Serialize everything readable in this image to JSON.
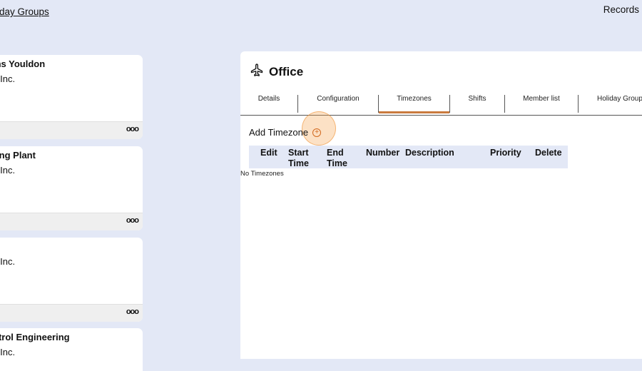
{
  "header": {
    "breadcrumb_link": "iday Groups",
    "records_label": "Records"
  },
  "cards": [
    {
      "title": "ins Youldon",
      "subtitle": "y Inc.",
      "more": "ooo"
    },
    {
      "title": "ring Plant",
      "subtitle": "y Inc.",
      "more": "ooo"
    },
    {
      "title": "",
      "subtitle": "y Inc.",
      "more": "ooo"
    },
    {
      "title": "ntrol Engineering",
      "subtitle": "y Inc.",
      "more": ""
    }
  ],
  "panel": {
    "title": "Office",
    "icon": "airplane-icon",
    "tabs": [
      {
        "label": "Details",
        "active": false
      },
      {
        "label": "Configuration",
        "active": false
      },
      {
        "label": "Timezones",
        "active": true
      },
      {
        "label": "Shifts",
        "active": false
      },
      {
        "label": "Member list",
        "active": false
      },
      {
        "label": "Holiday Group",
        "active": false
      }
    ],
    "add_label": "Add Timezone",
    "table": {
      "columns": [
        "Edit",
        "Start Time",
        "End Time",
        "Number",
        "Description",
        "Priority",
        "Delete"
      ],
      "empty_message": "No Timezones"
    }
  },
  "colors": {
    "background": "#e3e8f6",
    "accent": "#c97a3e",
    "add_icon": "#d2691e"
  }
}
